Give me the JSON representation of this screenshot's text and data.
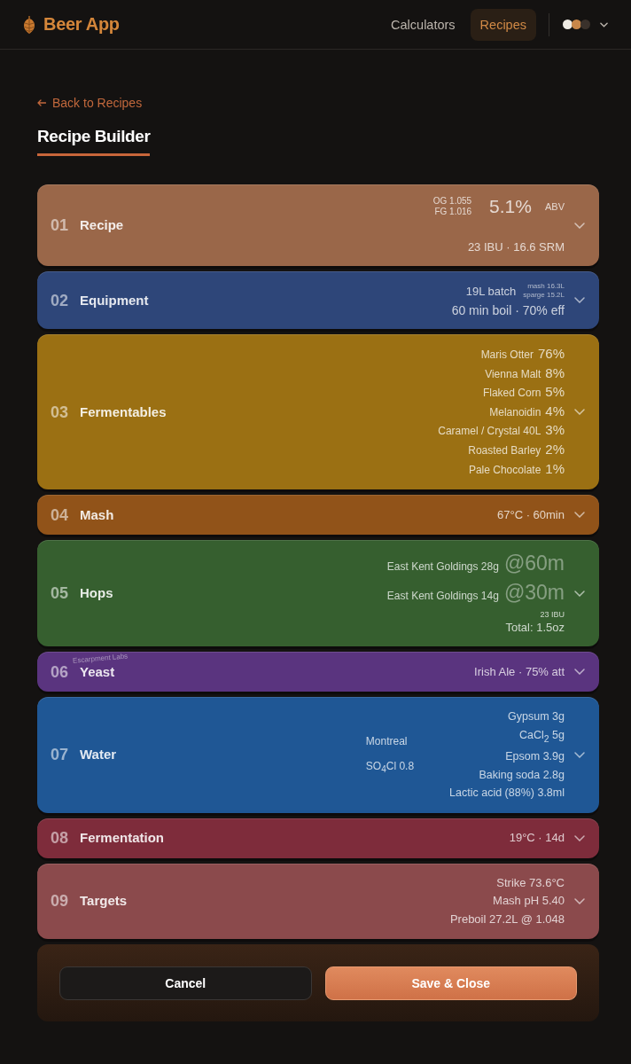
{
  "header": {
    "app_name": "Beer App",
    "nav": [
      {
        "label": "Calculators",
        "selected": false
      },
      {
        "label": "Recipes",
        "selected": true
      }
    ],
    "theme_dots": [
      {
        "color": "#efebe4"
      },
      {
        "color": "#c8874a"
      },
      {
        "color": "#3a312b"
      }
    ]
  },
  "back_link": "Back to Recipes",
  "title": "Recipe Builder",
  "sections": [
    {
      "number": "01",
      "title": "Recipe",
      "color": "#9a6749",
      "kind": "recipe",
      "og": "OG 1.055",
      "fg": "FG 1.016",
      "abv": "5.1%",
      "abv_label": "ABV",
      "line": "23 IBU · 16.6 SRM"
    },
    {
      "number": "02",
      "title": "Equipment",
      "color": "#2e4679",
      "kind": "equipment",
      "batch": "19L batch",
      "mash": "mash 16.3L",
      "sparge": "sparge 15.2L",
      "line": "60 min boil · 70% eff"
    },
    {
      "number": "03",
      "title": "Fermentables",
      "color": "#9b7013",
      "kind": "fermentables",
      "items": [
        {
          "name": "Maris Otter",
          "amount": "76%"
        },
        {
          "name": "Vienna Malt",
          "amount": "8%"
        },
        {
          "name": "Flaked Corn",
          "amount": "5%"
        },
        {
          "name": "Melanoidin",
          "amount": "4%"
        },
        {
          "name": "Caramel / Crystal 40L",
          "amount": "3%"
        },
        {
          "name": "Roasted Barley",
          "amount": "2%"
        },
        {
          "name": "Pale Chocolate",
          "amount": "1%"
        }
      ]
    },
    {
      "number": "04",
      "title": "Mash",
      "color": "#915319",
      "kind": "line",
      "line": "67°C · 60min"
    },
    {
      "number": "05",
      "title": "Hops",
      "color": "#365f2f",
      "kind": "hops",
      "items": [
        {
          "name": "East Kent Goldings 28g",
          "time": "@60m"
        },
        {
          "name": "East Kent Goldings 14g",
          "time": "@30m"
        }
      ],
      "ibu": "23 IBU",
      "total": "Total: 1.5oz"
    },
    {
      "number": "06",
      "title": "Yeast",
      "color": "#5a347f",
      "kind": "line",
      "lab": "Escarpment Labs",
      "line": "Irish Ale · 75% att"
    },
    {
      "number": "07",
      "title": "Water",
      "color": "#1f5795",
      "kind": "water",
      "profile": "Montreal",
      "ratio": "SO$_{4}$Cl 0.8",
      "items": [
        "Gypsum 3g",
        "CaCl$_{2}$ 5g",
        "Epsom 3.9g",
        "Baking soda 2.8g",
        "Lactic acid (88%) 3.8ml"
      ]
    },
    {
      "number": "08",
      "title": "Fermentation",
      "color": "#7e2c3b",
      "kind": "line",
      "line": "19°C · 14d"
    },
    {
      "number": "09",
      "title": "Targets",
      "color": "#8b4a4c",
      "kind": "targets",
      "items": [
        "Strike 73.6°C",
        "Mash pH 5.40",
        "Preboil 27.2L @ 1.048"
      ]
    }
  ],
  "footer": {
    "buttons": [
      {
        "label": "Cancel",
        "kind": "secondary"
      },
      {
        "label": "Save & Close",
        "kind": "primary"
      }
    ]
  }
}
